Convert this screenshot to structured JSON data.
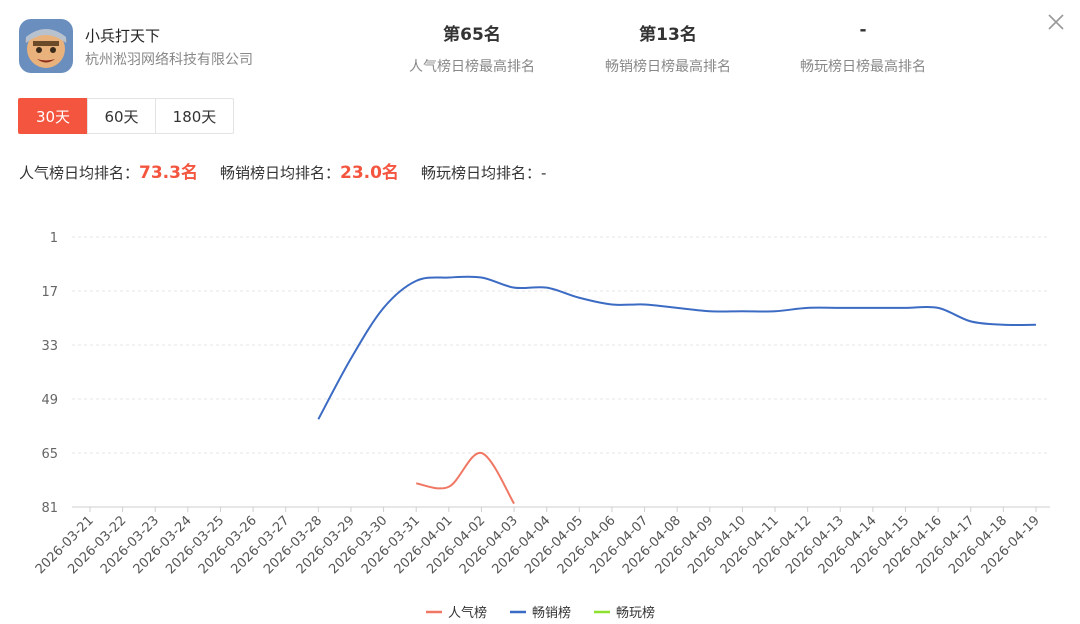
{
  "app": {
    "name": "小兵打天下",
    "company": "杭州淞羽网络科技有限公司",
    "icon": "game-character-icon"
  },
  "stats": [
    {
      "value": "第65名",
      "label": "人气榜日榜最高排名"
    },
    {
      "value": "第13名",
      "label": "畅销榜日榜最高排名"
    },
    {
      "value": "-",
      "label": "畅玩榜日榜最高排名"
    }
  ],
  "tabs": [
    {
      "label": "30天",
      "active": true
    },
    {
      "label": "60天",
      "active": false
    },
    {
      "label": "180天",
      "active": false
    }
  ],
  "averages": [
    {
      "label": "人气榜日均排名：",
      "value": "73.3名"
    },
    {
      "label": "畅销榜日均排名：",
      "value": "23.0名"
    },
    {
      "label": "畅玩榜日均排名：",
      "value": "-"
    }
  ],
  "chart_data": {
    "type": "line",
    "x": [
      "2026-03-21",
      "2026-03-22",
      "2026-03-23",
      "2026-03-24",
      "2026-03-25",
      "2026-03-26",
      "2026-03-27",
      "2026-03-28",
      "2026-03-29",
      "2026-03-30",
      "2026-03-31",
      "2026-04-01",
      "2026-04-02",
      "2026-04-03",
      "2026-04-04",
      "2026-04-05",
      "2026-04-06",
      "2026-04-07",
      "2026-04-08",
      "2026-04-09",
      "2026-04-10",
      "2026-04-11",
      "2026-04-12",
      "2026-04-13",
      "2026-04-14",
      "2026-04-15",
      "2026-04-16",
      "2026-04-17",
      "2026-04-18",
      "2026-04-19"
    ],
    "ylim": [
      1,
      81
    ],
    "y_inverted": true,
    "yticks": [
      1,
      17,
      33,
      49,
      65,
      81
    ],
    "grid": true,
    "legend_position": "bottom",
    "series": [
      {
        "name": "人气榜",
        "color": "#f07763",
        "values": [
          null,
          null,
          null,
          null,
          null,
          null,
          null,
          null,
          null,
          null,
          74,
          75,
          65,
          80,
          null,
          null,
          null,
          null,
          null,
          null,
          null,
          null,
          null,
          null,
          null,
          null,
          null,
          null,
          null,
          null
        ]
      },
      {
        "name": "畅销榜",
        "color": "#3c6bc4",
        "values": [
          null,
          null,
          null,
          null,
          null,
          null,
          null,
          55,
          37,
          22,
          14,
          13,
          13,
          16,
          16,
          19,
          21,
          21,
          22,
          23,
          23,
          23,
          22,
          22,
          22,
          22,
          22,
          26,
          27,
          27
        ]
      },
      {
        "name": "畅玩榜",
        "color": "#8ee02f",
        "values": []
      }
    ]
  }
}
